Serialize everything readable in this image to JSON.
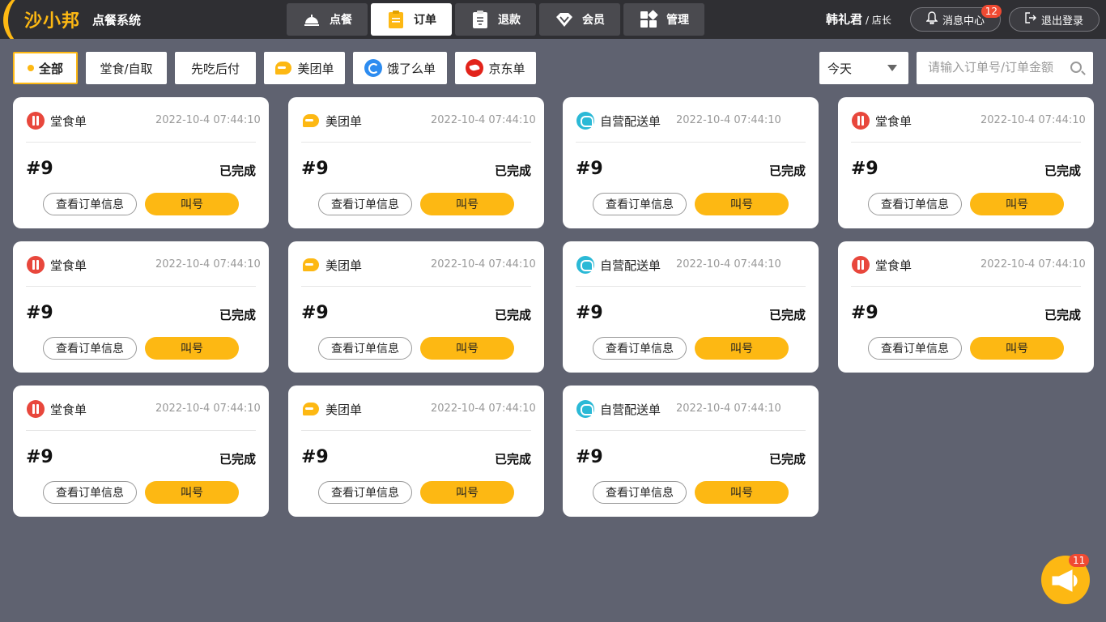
{
  "app": {
    "brand": "沙小邦",
    "subtitle": "点餐系统"
  },
  "nav": {
    "tabs": [
      {
        "label": "点餐",
        "icon": "cloche-icon"
      },
      {
        "label": "订单",
        "icon": "clipboard-icon",
        "active": true
      },
      {
        "label": "退款",
        "icon": "refund-icon"
      },
      {
        "label": "会员",
        "icon": "diamond-icon"
      },
      {
        "label": "管理",
        "icon": "grid-icon"
      }
    ]
  },
  "user": {
    "name": "韩礼君",
    "role": "/ 店长"
  },
  "header_buttons": {
    "messages": {
      "label": "消息中心",
      "badge": "12",
      "icon": "bell-icon"
    },
    "logout": {
      "label": "退出登录",
      "icon": "logout-icon"
    }
  },
  "filters": [
    {
      "label": "全部",
      "active": true
    },
    {
      "label": "堂食/自取"
    },
    {
      "label": "先吃后付"
    },
    {
      "label": "美团单",
      "icon": "meituan-icon"
    },
    {
      "label": "饿了么单",
      "icon": "eleme-icon"
    },
    {
      "label": "京东单",
      "icon": "jd-icon"
    }
  ],
  "date_select": {
    "value": "今天"
  },
  "search": {
    "placeholder": "请输入订单号/订单金额"
  },
  "orders": [
    {
      "type": "堂食单",
      "time": "2022-10-4  07:44:10",
      "number": "#9",
      "status": "已完成"
    },
    {
      "type": "美团单",
      "time": "2022-10-4  07:44:10",
      "number": "#9",
      "status": "已完成"
    },
    {
      "type": "自营配送单",
      "time": "2022-10-4  07:44:10",
      "number": "#9",
      "status": "已完成"
    },
    {
      "type": "堂食单",
      "time": "2022-10-4  07:44:10",
      "number": "#9",
      "status": "已完成"
    },
    {
      "type": "堂食单",
      "time": "2022-10-4  07:44:10",
      "number": "#9",
      "status": "已完成"
    },
    {
      "type": "美团单",
      "time": "2022-10-4  07:44:10",
      "number": "#9",
      "status": "已完成"
    },
    {
      "type": "自营配送单",
      "time": "2022-10-4  07:44:10",
      "number": "#9",
      "status": "已完成"
    },
    {
      "type": "堂食单",
      "time": "2022-10-4  07:44:10",
      "number": "#9",
      "status": "已完成"
    },
    {
      "type": "堂食单",
      "time": "2022-10-4  07:44:10",
      "number": "#9",
      "status": "已完成"
    },
    {
      "type": "美团单",
      "time": "2022-10-4  07:44:10",
      "number": "#9",
      "status": "已完成"
    },
    {
      "type": "自营配送单",
      "time": "2022-10-4  07:44:10",
      "number": "#9",
      "status": "已完成"
    }
  ],
  "card_buttons": {
    "view": "查看订单信息",
    "call": "叫号"
  },
  "announcement": {
    "badge": "11",
    "icon": "megaphone-icon"
  },
  "colors": {
    "accent": "#fdb813",
    "topbar": "#2f2f33",
    "background": "#5f6270",
    "badge": "#f04a32"
  }
}
